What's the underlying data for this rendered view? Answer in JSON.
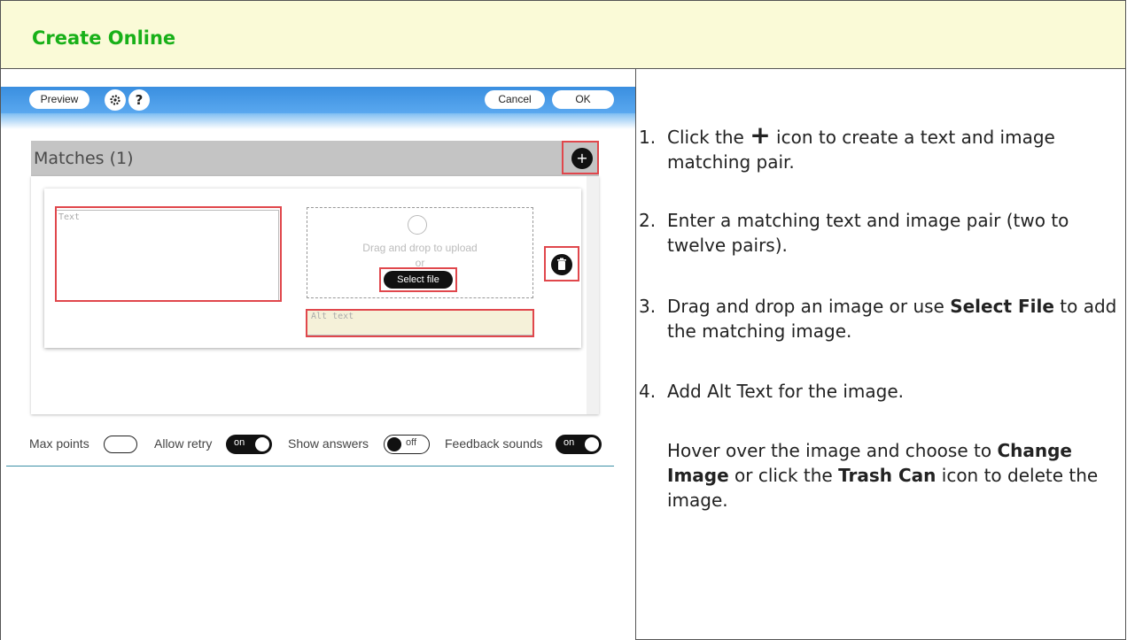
{
  "header": {
    "title": "Create Online"
  },
  "toolbar": {
    "preview_label": "Preview",
    "settings_icon": "gear-icon",
    "help_label": "?",
    "cancel_label": "Cancel",
    "ok_label": "OK"
  },
  "matches": {
    "title": "Matches (1)",
    "add_icon_label": "+",
    "text_placeholder": "Text",
    "dropzone_text": "Drag and drop to upload",
    "dropzone_or": "or",
    "select_file_label": "Select file",
    "alt_placeholder": "Alt text"
  },
  "options": {
    "max_points_label": "Max points",
    "allow_retry_label": "Allow retry",
    "allow_retry_state": "on",
    "show_answers_label": "Show answers",
    "show_answers_state": "off",
    "feedback_sounds_label": "Feedback sounds",
    "feedback_sounds_state": "on"
  },
  "instructions": {
    "step1_num": "1.",
    "step1_a": "Click the",
    "step1_icon": "+",
    "step1_b": "icon to create a text and image matching pair.",
    "step2_num": "2.",
    "step2": "Enter a matching text and image pair (two to twelve pairs).",
    "step3_num": "3.",
    "step3_a": "Drag and drop an image or use",
    "step3_bold": "Select File",
    "step3_b": "to add the matching image.",
    "step4_num": "4.",
    "step4": "Add Alt Text for the image.",
    "hover_a": "Hover over the image and choose to",
    "hover_bold1": "Change Image",
    "hover_b": "or click the",
    "hover_bold2": "Trash Can",
    "hover_c": "icon to delete the image."
  }
}
